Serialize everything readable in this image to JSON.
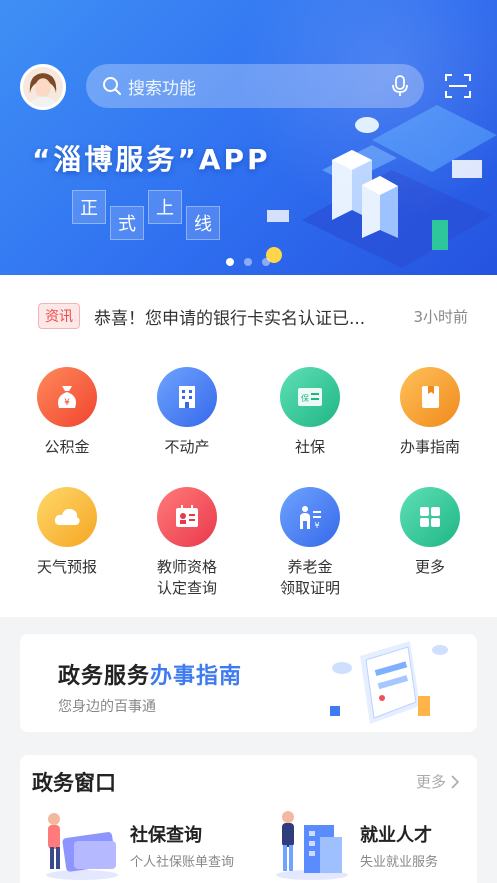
{
  "banner": {
    "search_placeholder": "搜索功能",
    "slogan": "“淄博服务”APP",
    "stamps": [
      "正",
      "式",
      "上",
      "线"
    ],
    "carousel_count": 3,
    "carousel_active": 0
  },
  "news": {
    "tag": "资讯",
    "text": "恭喜！您申请的银行卡实名认证已...",
    "time": "3小时前"
  },
  "services": [
    {
      "label": "公积金",
      "icon": "money-bag-icon",
      "color": "#f3563c"
    },
    {
      "label": "不动产",
      "icon": "building-icon",
      "color": "#3f7bf0"
    },
    {
      "label": "社保",
      "icon": "insurance-card-icon",
      "color": "#2ec79b"
    },
    {
      "label": "办事指南",
      "icon": "guide-book-icon",
      "color": "#f59a26"
    },
    {
      "label": "天气预报",
      "icon": "cloud-icon",
      "color": "#f7b733"
    },
    {
      "label": "教师资格\n认定查询",
      "icon": "teacher-certificate-icon",
      "color": "#f0505a"
    },
    {
      "label": "养老金\n领取证明",
      "icon": "pension-icon",
      "color": "#3f7bf0"
    },
    {
      "label": "更多",
      "icon": "grid-more-icon",
      "color": "#2ec79b"
    }
  ],
  "guide": {
    "title_prefix": "政务服务",
    "title_highlight": "办事指南",
    "subtitle": "您身边的百事通"
  },
  "window": {
    "title": "政务窗口",
    "more_label": "更多",
    "items": [
      {
        "name": "社保查询",
        "desc": "个人社保账单查询"
      },
      {
        "name": "就业人才",
        "desc": "失业就业服务"
      }
    ]
  }
}
